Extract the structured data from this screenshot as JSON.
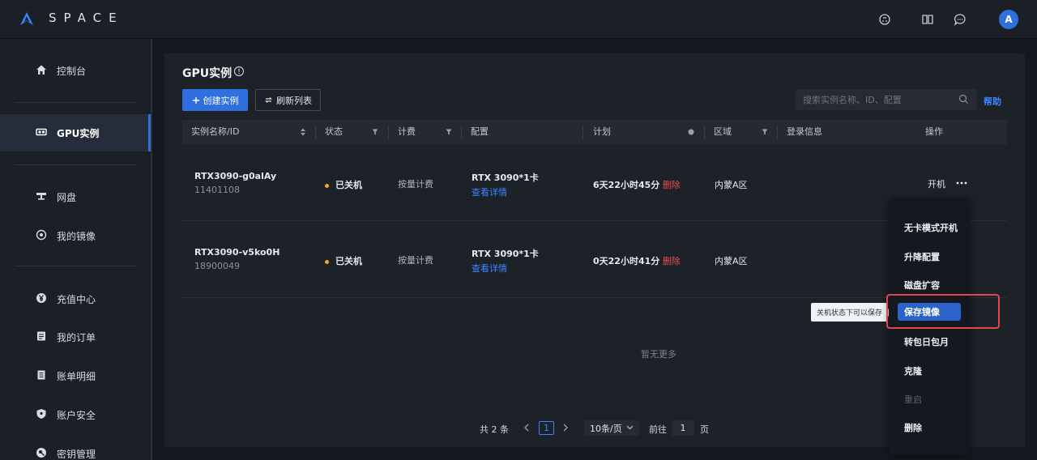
{
  "header": {
    "logo_text": "SPACE",
    "avatar_letter": "A",
    "icons": [
      "github-icon",
      "book-icon",
      "chat-icon"
    ]
  },
  "sidebar": {
    "items": [
      {
        "label": "控制台",
        "icon": "home-icon"
      },
      {
        "label": "GPU实例",
        "icon": "gpu-icon",
        "active": true
      },
      {
        "label": "网盘",
        "icon": "disk-icon"
      },
      {
        "label": "我的镜像",
        "icon": "image-icon"
      },
      {
        "label": "充值中心",
        "icon": "yen-icon"
      },
      {
        "label": "我的订单",
        "icon": "order-icon"
      },
      {
        "label": "账单明细",
        "icon": "bill-icon"
      },
      {
        "label": "账户安全",
        "icon": "shield-icon"
      },
      {
        "label": "密钥管理",
        "icon": "key-icon"
      }
    ]
  },
  "main": {
    "title": "GPU实例",
    "create_button": "创建实例",
    "refresh_button": "刷新列表",
    "search_placeholder": "搜索实例名称、ID、配置",
    "help_link": "帮助"
  },
  "table": {
    "columns": [
      "实例名称/ID",
      "状态",
      "计费",
      "配置",
      "计划",
      "区域",
      "登录信息",
      "操作"
    ],
    "rows": [
      {
        "name": "RTX3090-g0alAy",
        "id": "11401108",
        "status": "已关机",
        "billing": "按量计费",
        "config": "RTX 3090*1卡",
        "config_link": "查看详情",
        "plan": "6天22小时45分",
        "plan_delete": "删除",
        "region": "内蒙A区",
        "action": "开机"
      },
      {
        "name": "RTX3090-v5ko0H",
        "id": "18900049",
        "status": "已关机",
        "billing": "按量计费",
        "config": "RTX 3090*1卡",
        "config_link": "查看详情",
        "plan": "0天22小时41分",
        "plan_delete": "删除",
        "region": "内蒙A区"
      }
    ],
    "no_more": "暂无更多"
  },
  "pagination": {
    "total": "共 2 条",
    "current_page": "1",
    "page_size": "10条/页",
    "goto_label": "前往",
    "goto_value": "1",
    "page_suffix": "页"
  },
  "tooltip": "关机状态下可以保存",
  "dropdown": {
    "items": [
      {
        "label": "无卡模式开机"
      },
      {
        "label": "升降配置"
      },
      {
        "label": "磁盘扩容"
      },
      {
        "label": "保存镜像",
        "highlighted": true
      },
      {
        "label": "转包日包月"
      },
      {
        "label": "克隆"
      },
      {
        "label": "重启",
        "disabled": true
      },
      {
        "label": "删除"
      }
    ]
  },
  "colors": {
    "accent": "#2f6fde",
    "link": "#3b86ff",
    "danger": "#ef4c4c",
    "status_stopped": "#f5a623",
    "highlight_box": "#e04848"
  }
}
